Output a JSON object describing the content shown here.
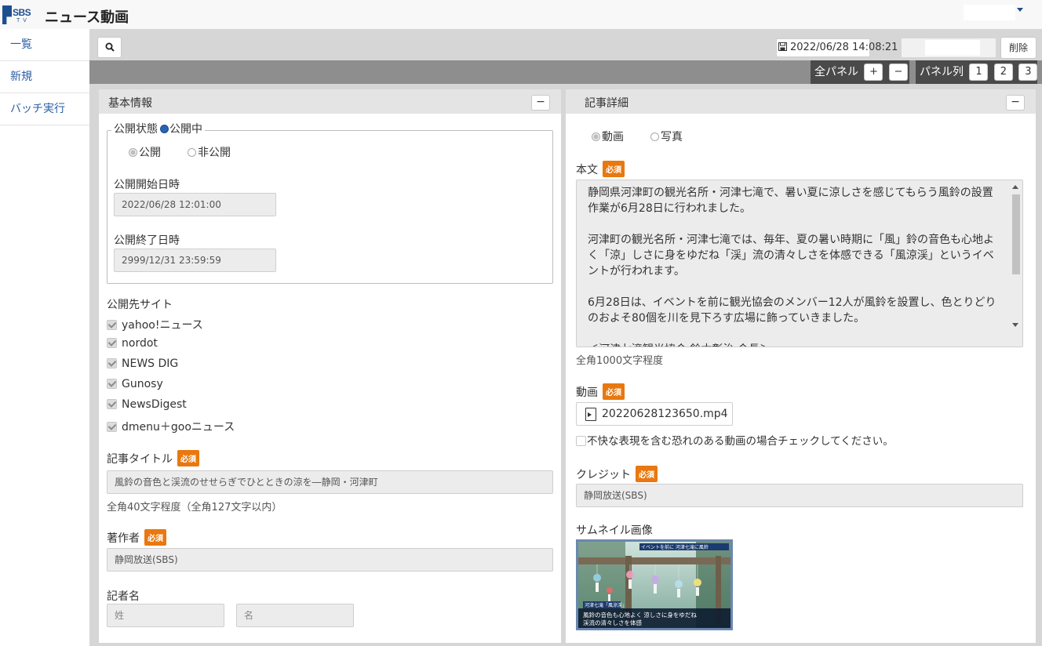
{
  "app": {
    "logo_text": "SBS",
    "logo_sub": "TV",
    "title": "ニュース動画"
  },
  "sidebar": {
    "items": [
      {
        "label": "一覧"
      },
      {
        "label": "新規"
      },
      {
        "label": "バッチ実行"
      }
    ]
  },
  "toolbar": {
    "saved_at": "2022/06/28 14:08:21",
    "delete_label": "削除"
  },
  "panelbar": {
    "all_panels_label": "全パネル",
    "plus": "+",
    "minus": "−",
    "columns_label": "パネル列",
    "col1": "1",
    "col2": "2",
    "col3": "3"
  },
  "basic": {
    "title": "基本情報",
    "collapse": "−",
    "status_label": "公開状態",
    "status_value": "公開中",
    "radio_public": "公開",
    "radio_private": "非公開",
    "start_label": "公開開始日時",
    "start_value": "2022/06/28 12:01:00",
    "end_label": "公開終了日時",
    "end_value": "2999/12/31 23:59:59",
    "sites_label": "公開先サイト",
    "sites": [
      "yahoo!ニュース",
      "nordot",
      "NEWS DIG",
      "Gunosy",
      "NewsDigest",
      "dmenu＋gooニュース"
    ],
    "article_title_label": "記事タイトル",
    "required": "必須",
    "article_title_value": "風鈴の音色と渓流のせせらぎでひとときの涼を―静岡・河津町",
    "article_title_hint": "全角40文字程度（全角127文字以内）",
    "author_label": "著作者",
    "author_value": "静岡放送(SBS)",
    "reporter_label": "記者名",
    "reporter_last_placeholder": "姓",
    "reporter_first_placeholder": "名"
  },
  "detail": {
    "title": "記事詳細",
    "collapse": "−",
    "radio_video": "動画",
    "radio_photo": "写真",
    "body_label": "本文",
    "required": "必須",
    "body_text": "静岡県河津町の観光名所・河津七滝で、暑い夏に涼しさを感じてもらう風鈴の設置作業が6月28日に行われました。\n\n河津町の観光名所・河津七滝では、毎年、夏の暑い時期に「風」鈴の音色も心地よく「涼」しさに身をゆだね「渓」流の清々しさを体感できる「風涼渓」というイベントが行われます。\n\n6月28日は、イベントを前に観光協会のメンバー12人が風鈴を設置し、色とりどりのおよそ80個を川を見下ろす広場に飾っていきました。\n\n＜河津七滝観光協会 鈴木彰治 会長＞",
    "body_hint": "全角1000文字程度",
    "video_label": "動画",
    "video_file": "20220628123650.mp4",
    "video_warning": "不快な表現を含む恐れのある動画の場合チェックしてください。",
    "credit_label": "クレジット",
    "credit_value": "静岡放送(SBS)",
    "thumb_label": "サムネイル画像",
    "thumb_caption_top": "イベントを前に 河津七滝に風鈴",
    "thumb_tag": "河津七滝「風涼渓」",
    "thumb_line1": "風鈴の音色も心地よく 涼しさに身をゆだね",
    "thumb_line2": "渓流の清々しさを体感"
  },
  "colors": {
    "accent": "#2a5ea6",
    "required_badge": "#e8780f",
    "panel_bg": "#d6d6d6",
    "bar_dark": "#4a4a4a"
  }
}
